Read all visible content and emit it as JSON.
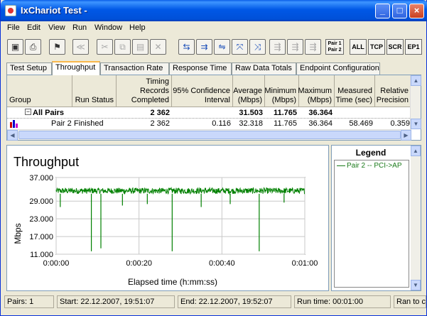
{
  "window": {
    "title": "IxChariot Test -"
  },
  "menu": [
    "File",
    "Edit",
    "View",
    "Run",
    "Window",
    "Help"
  ],
  "toolbar": {
    "pair_label_1": "Pair 1",
    "pair_label_2": "Pair 2",
    "text_buttons": [
      "ALL",
      "TCP",
      "SCR",
      "EP1"
    ]
  },
  "tabs": [
    "Test Setup",
    "Throughput",
    "Transaction Rate",
    "Response Time",
    "Raw Data Totals",
    "Endpoint Configuration"
  ],
  "active_tab": "Throughput",
  "table": {
    "headers": [
      "Group",
      "Run Status",
      "Timing Records Completed",
      "95% Confidence Interval",
      "Average (Mbps)",
      "Minimum (Mbps)",
      "Maximum (Mbps)",
      "Measured Time (sec)",
      "Relative Precision"
    ],
    "all_pairs": {
      "group": "All Pairs",
      "records": "2 362",
      "average": "31.503",
      "minimum": "11.765",
      "maximum": "36.364"
    },
    "pair2": {
      "group": "Pair 2",
      "status": "Finished",
      "records": "2 362",
      "confidence": "0.116",
      "average": "32.318",
      "minimum": "11.765",
      "maximum": "36.364",
      "measured_time": "58.469",
      "precision": "0.359"
    }
  },
  "chart_data": {
    "type": "line",
    "title": "Throughput",
    "xlabel": "Elapsed time (h:mm:ss)",
    "ylabel": "Mbps",
    "yticks": [
      "37.000",
      "29.000",
      "23.000",
      "17.000",
      "11.000"
    ],
    "ytick_values": [
      37,
      29,
      23,
      17,
      11
    ],
    "ylim": [
      11,
      37
    ],
    "xticks": [
      "0:00:00",
      "0:00:20",
      "0:00:40",
      "0:01:00"
    ],
    "xlim": [
      0,
      60
    ],
    "grid": true,
    "series": [
      {
        "name": "Pair 2 -- PCI->AP",
        "color": "#008000",
        "baseline_range": [
          31.5,
          33.5
        ],
        "dips": [
          {
            "x": 8.5,
            "y": 12.0
          },
          {
            "x": 10.8,
            "y": 13.0
          },
          {
            "x": 28.0,
            "y": 12.0
          },
          {
            "x": 49.0,
            "y": 12.0
          },
          {
            "x": 1.0,
            "y": 27.0
          },
          {
            "x": 16.0,
            "y": 27.5
          },
          {
            "x": 22.0,
            "y": 28.0
          },
          {
            "x": 35.0,
            "y": 27.0
          },
          {
            "x": 42.0,
            "y": 28.0
          },
          {
            "x": 55.0,
            "y": 28.5
          }
        ]
      }
    ]
  },
  "legend": {
    "title": "Legend",
    "entry": "Pair 2 -- PCI->AP"
  },
  "status": {
    "pairs": "Pairs: 1",
    "start": "Start: 22.12.2007, 19:51:07",
    "end": "End: 22.12.2007, 19:52:07",
    "run_time": "Run time: 00:01:00",
    "ran": "Ran to c"
  }
}
